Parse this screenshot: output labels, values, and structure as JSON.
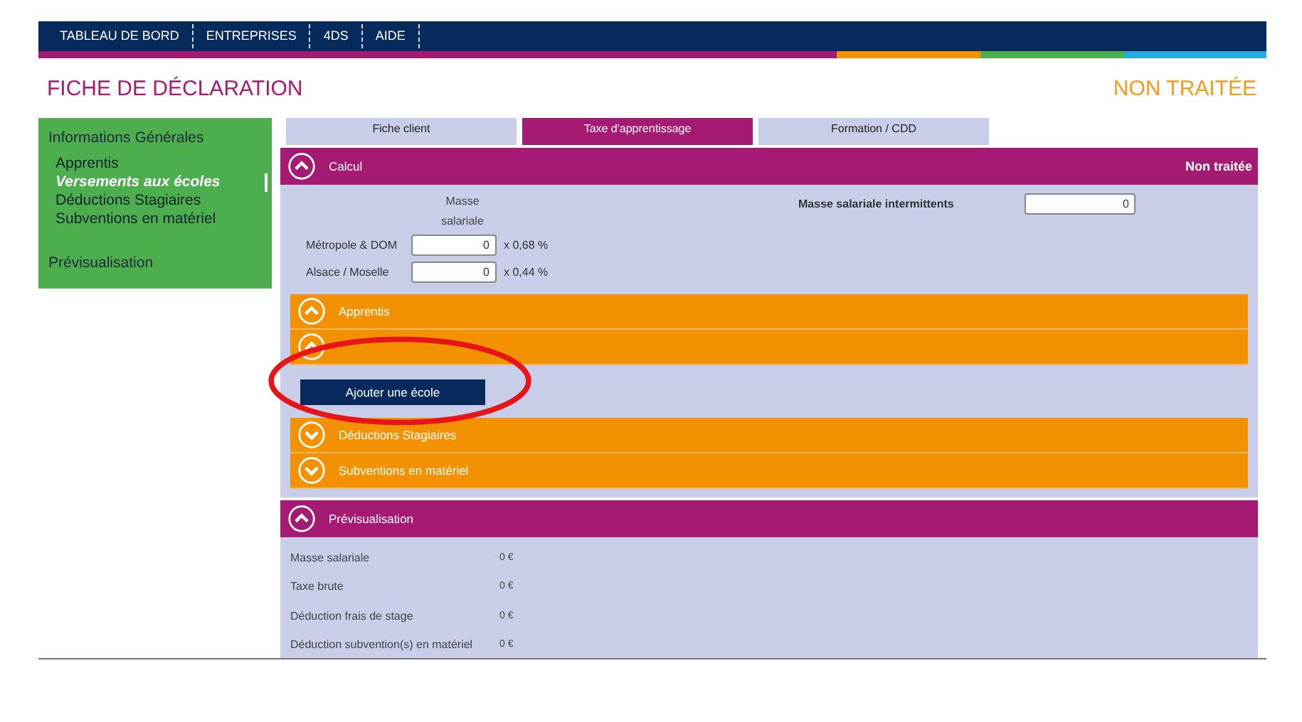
{
  "nav": [
    "TABLEAU DE BORD",
    "ENTREPRISES",
    "4DS",
    "AIDE"
  ],
  "page": {
    "title": "FICHE DE DÉCLARATION",
    "status": "NON TRAITÉE"
  },
  "sidebar": {
    "items": [
      {
        "label": "Informations Générales",
        "children": [
          {
            "label": "Apprentis",
            "selected": false
          },
          {
            "label": "Versements aux écoles",
            "selected": true
          },
          {
            "label": "Déductions Stagiaires",
            "selected": false
          },
          {
            "label": "Subventions en matériel",
            "selected": false
          }
        ]
      },
      {
        "label": "Prévisualisation"
      }
    ]
  },
  "tabs": [
    {
      "label": "Fiche client",
      "selected": false
    },
    {
      "label": "Taxe d'apprentissage",
      "selected": true
    },
    {
      "label": "Formation / CDD",
      "selected": false
    }
  ],
  "calcul": {
    "title": "Calcul",
    "status": "Non traitée",
    "expanded": true,
    "column_header": "Masse salariale",
    "rows": [
      {
        "label": "Métropole & DOM",
        "value": "0",
        "rate": "x 0,68 %"
      },
      {
        "label": "Alsace / Moselle",
        "value": "0",
        "rate": "x 0,44 %"
      }
    ],
    "intermittents": {
      "label": "Masse salariale intermittents",
      "value": "0"
    }
  },
  "sections": [
    {
      "title": "Apprentis",
      "expanded": true
    },
    {
      "expanded": true,
      "button": "Ajouter une école"
    },
    {
      "title": "Déductions Stagiaires",
      "expanded": false
    },
    {
      "title": "Subventions en matériel",
      "expanded": false
    }
  ],
  "preview": {
    "title": "Prévisualisation",
    "expanded": true,
    "rows": [
      {
        "label": "Masse salariale",
        "value": "0 €"
      },
      {
        "label": "Taxe brute",
        "value": "0 €"
      },
      {
        "label": "Déduction frais de stage",
        "value": "0 €"
      },
      {
        "label": "Déduction subvention(s) en matériel",
        "value": "0 €"
      }
    ]
  }
}
